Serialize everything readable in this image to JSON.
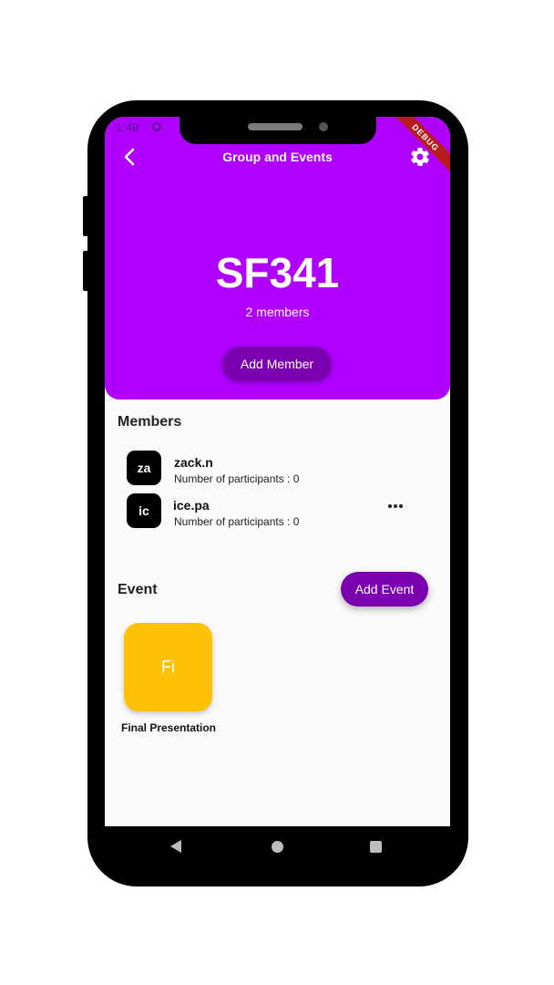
{
  "status_bar": {
    "time": "1:49",
    "debug_label": "DEBUG"
  },
  "header": {
    "title": "Group and Events",
    "group_name": "SF341",
    "members_count": "2 members",
    "add_member_label": "Add Member"
  },
  "members": {
    "section_title": "Members",
    "items": [
      {
        "initials": "za",
        "name": "zack.n",
        "subtitle": "Number of participants : 0"
      },
      {
        "initials": "ic",
        "name": "ice.pa",
        "subtitle": "Number of participants : 0"
      }
    ]
  },
  "events": {
    "section_title": "Event",
    "add_event_label": "Add Event",
    "items": [
      {
        "initials": "Fi",
        "name": "Final Presentation",
        "color": "#ffc107"
      }
    ]
  },
  "colors": {
    "accent": "#b000ff",
    "button": "#7a00b0"
  },
  "icons": {
    "back": "chevron-left-icon",
    "settings": "gear-icon",
    "more": "more-horizontal-icon"
  }
}
